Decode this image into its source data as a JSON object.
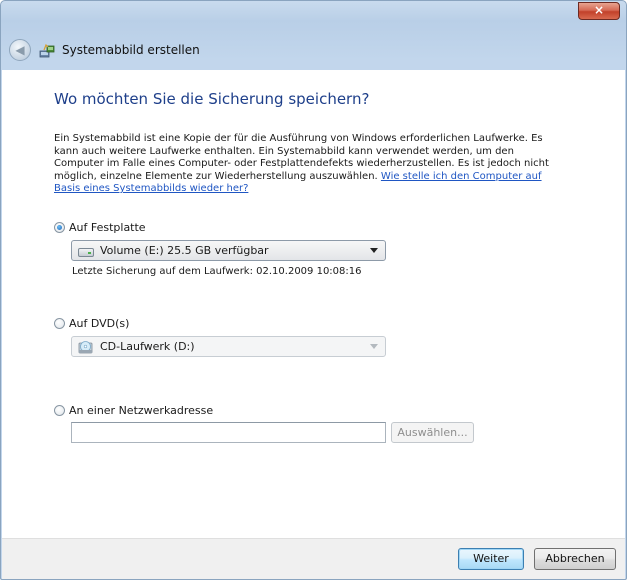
{
  "window": {
    "close_label": "×",
    "title": "Systemabbild erstellen"
  },
  "nav": {
    "back_glyph": "◀"
  },
  "main": {
    "heading": "Wo möchten Sie die Sicherung speichern?",
    "description": "Ein Systemabbild ist eine Kopie der für die Ausführung von Windows erforderlichen Laufwerke. Es kann auch weitere Laufwerke enthalten. Ein Systemabbild kann verwendet werden, um den Computer im Falle eines Computer- oder Festplattendefekts wiederherzustellen. Es ist jedoch nicht möglich, einzelne Elemente zur Wiederherstellung auszuwählen.",
    "help_link": "Wie stelle ich den Computer auf Basis eines Systemabbilds wieder her?"
  },
  "options": {
    "hard_disk": {
      "label": "Auf Festplatte",
      "selected": true,
      "combo_value": "Volume (E:)  25.5 GB verfügbar",
      "last_backup": "Letzte Sicherung auf dem Laufwerk: 02.10.2009 10:08:16"
    },
    "dvd": {
      "label": "Auf DVD(s)",
      "selected": false,
      "combo_value": "CD-Laufwerk (D:)"
    },
    "network": {
      "label": "An einer Netzwerkadresse",
      "selected": false,
      "input_value": "",
      "select_button": "Auswählen..."
    }
  },
  "footer": {
    "next_label": "Weiter",
    "cancel_label": "Abbrechen"
  },
  "colors": {
    "heading": "#1e3f8a",
    "link": "#1f56c3",
    "close_button": "#c2412a"
  }
}
